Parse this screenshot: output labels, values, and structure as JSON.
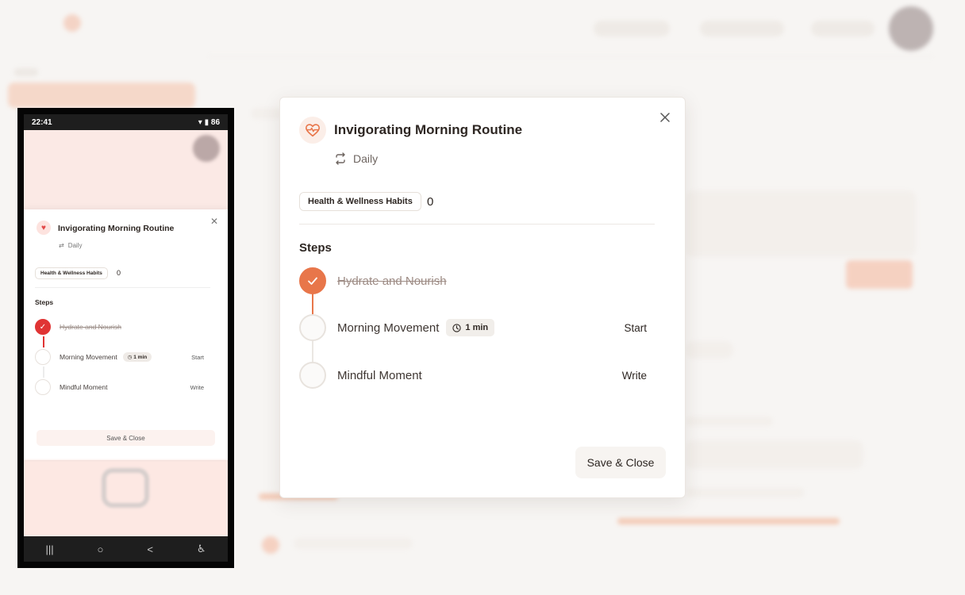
{
  "modal": {
    "title": "Invigorating Morning Routine",
    "frequency": "Daily",
    "category": "Health & Wellness Habits",
    "count": "0",
    "steps_heading": "Steps",
    "steps": [
      {
        "label": "Hydrate and Nourish",
        "completed": true,
        "badge": "",
        "action": ""
      },
      {
        "label": "Morning Movement",
        "completed": false,
        "badge": "1 min",
        "action": "Start"
      },
      {
        "label": "Mindful Moment",
        "completed": false,
        "badge": "",
        "action": "Write"
      }
    ],
    "save_label": "Save & Close"
  },
  "phone": {
    "status_time": "22:41",
    "status_right": "▾ ▮ 86",
    "title": "Invigorating Morning Routine",
    "frequency": "Daily",
    "category": "Health & Wellness Habits",
    "count": "0",
    "steps_heading": "Steps",
    "steps": [
      {
        "label": "Hydrate and Nourish",
        "badge": "",
        "action": ""
      },
      {
        "label": "Morning Movement",
        "badge": "1 min",
        "action": "Start"
      },
      {
        "label": "Mindful Moment",
        "badge": "",
        "action": "Write"
      }
    ],
    "save_label": "Save & Close",
    "nav": [
      "|||",
      "○",
      "<",
      "♿"
    ]
  },
  "colors": {
    "accent": "#e8764a",
    "phone_accent": "#e03434",
    "background": "#f7f5f3"
  },
  "icons": {
    "heart": "heart-pulse-icon",
    "repeat": "repeat-icon",
    "clock": "clock-icon",
    "check": "check-icon",
    "close": "close-icon"
  }
}
